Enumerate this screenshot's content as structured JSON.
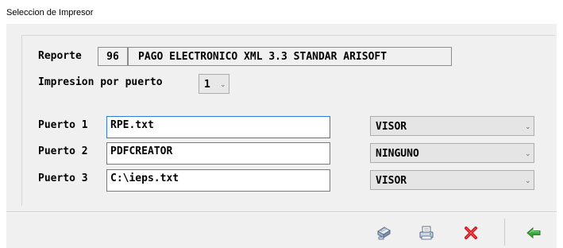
{
  "window": {
    "title": "Seleccion de Impresor"
  },
  "report": {
    "label": "Reporte",
    "number": "96",
    "name": "PAGO ELECTRONICO XML 3.3 STANDAR ARISOFT"
  },
  "print_port": {
    "label": "Impresion por puerto",
    "selected": "1"
  },
  "ports": [
    {
      "label": "Puerto 1",
      "value": "RPE.txt",
      "mode": "VISOR"
    },
    {
      "label": "Puerto 2",
      "value": "PDFCREATOR",
      "mode": "NINGUNO"
    },
    {
      "label": "Puerto 3",
      "value": "C:\\ieps.txt",
      "mode": "VISOR"
    }
  ],
  "toolbar": {
    "icons": [
      "printer-setup-icon",
      "print-icon",
      "cancel-icon",
      "back-arrow-icon"
    ]
  },
  "colors": {
    "accent_red": "#d0141c",
    "accent_green": "#3fa63f",
    "focus_border": "#2f7bd8"
  }
}
